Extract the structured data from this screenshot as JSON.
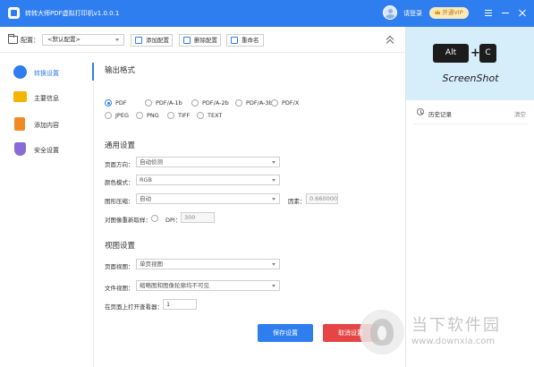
{
  "colors": {
    "primary": "#2f7ef0",
    "danger": "#e64545",
    "vip_bg": "#fde9b8",
    "banner_bg": "#d6eefa"
  },
  "titlebar": {
    "title": "转转大师PDF虚拟打印机v1.0.0.1",
    "login": "请登录",
    "vip": "开通VIP",
    "icons": [
      "app-logo-icon",
      "avatar-icon",
      "crown-icon",
      "menu-icon",
      "minimize-icon",
      "close-icon"
    ]
  },
  "toolbar": {
    "config_label": "配置：",
    "config_value": "<默认配置>",
    "add": "添加配置",
    "delete": "删除配置",
    "rename": "重命名"
  },
  "sidebar": {
    "items": [
      {
        "label": "转换设置",
        "icon": "convert-icon",
        "active": true
      },
      {
        "label": "主要信息",
        "icon": "folder-icon",
        "active": false
      },
      {
        "label": "添加内容",
        "icon": "document-icon",
        "active": false
      },
      {
        "label": "安全设置",
        "icon": "shield-icon",
        "active": false
      }
    ]
  },
  "output": {
    "title": "输出格式",
    "formats": [
      "PDF",
      "PDF/A-1b",
      "PDF/A-2b",
      "PDF/A-3b",
      "PDF/X",
      "JPEG",
      "PNG",
      "TIFF",
      "TEXT"
    ],
    "selected": "PDF"
  },
  "general": {
    "title": "通用设置",
    "orientation_label": "页面方向：",
    "orientation_value": "自动侦测",
    "color_label": "颜色模式：",
    "color_value": "RGB",
    "compression_label": "图形压缩：",
    "compression_value": "自动",
    "factor_label": "因素：",
    "factor_value": "0.660000",
    "resample_label": "对图像重新取样：",
    "dpi_label": "DPI：",
    "dpi_value": "300"
  },
  "view": {
    "title": "视图设置",
    "page_view_label": "页面视图：",
    "page_view_value": "单页视图",
    "doc_view_label": "文件视图：",
    "doc_view_value": "缩略图和图像轮廓均不可见",
    "open_page_label": "在页面上打开查看器：",
    "open_page_value": "1"
  },
  "actions": {
    "save": "保存设置",
    "cancel": "取消设置"
  },
  "right_panel": {
    "key_alt": "Alt",
    "key_plus": "+",
    "key_c": "C",
    "brand": "ScreenShot",
    "history_label": "历史记录",
    "clear": "清空"
  },
  "watermark": {
    "cn": "当下软件园",
    "url": "www.downxia.com"
  }
}
